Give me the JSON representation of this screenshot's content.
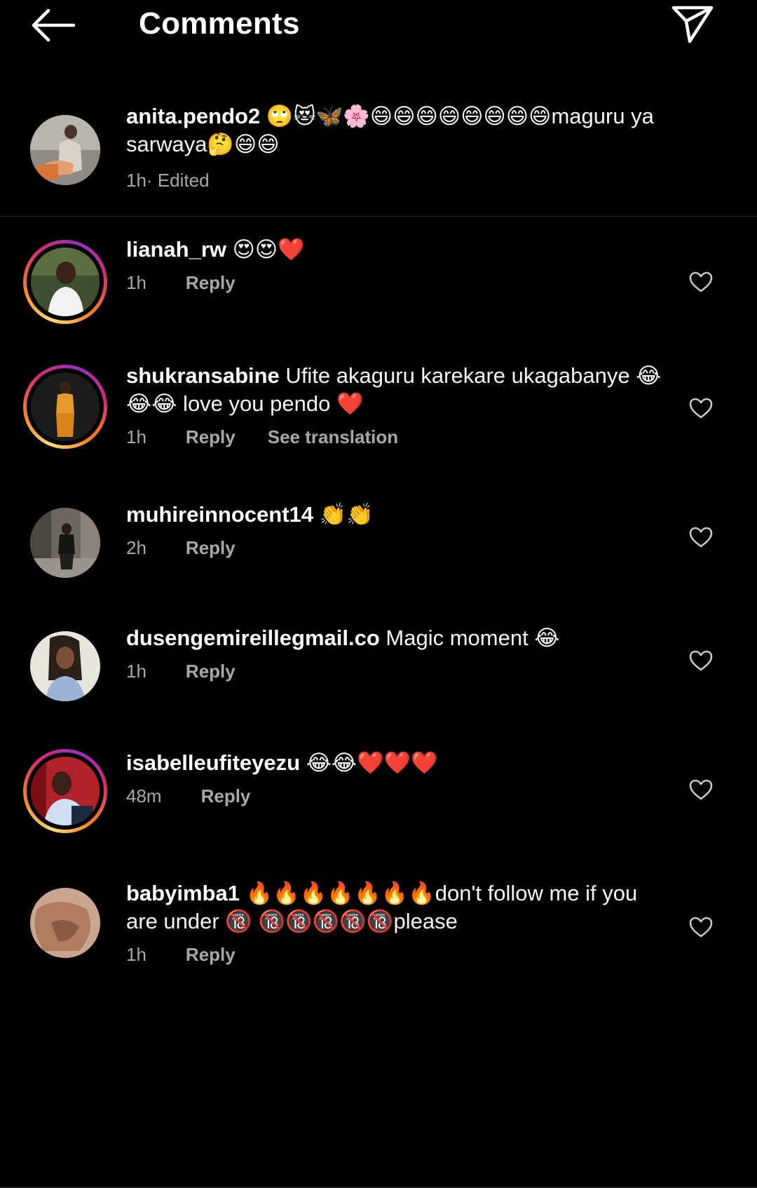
{
  "header": {
    "title": "Comments",
    "back_icon": "arrow-left-icon",
    "share_icon": "paper-plane-icon"
  },
  "caption": {
    "username": "anita.pendo2",
    "text": " 🙄😻🦋🌸😄😄😄😄😄😄😄😄maguru ya sarwaya🤔😄😄",
    "time": "1h",
    "edited": " · Edited"
  },
  "comments": [
    {
      "username": "lianah_rw",
      "text": " 😍😍❤️",
      "time": "1h",
      "reply": "Reply",
      "has_story_ring": true
    },
    {
      "username": "shukransabine",
      "text": " Ufite akaguru karekare  ukagabanye 😂 😂😂 love you pendo ❤️",
      "time": "1h",
      "reply": "Reply",
      "see_translation": "See translation",
      "has_story_ring": true
    },
    {
      "username": "muhireinnocent14",
      "text": " 👏👏",
      "time": "2h",
      "reply": "Reply",
      "has_story_ring": false
    },
    {
      "username": "dusengemireillegmail.co",
      "text": " Magic moment 😂",
      "time": "1h",
      "reply": "Reply",
      "has_story_ring": false
    },
    {
      "username": "isabelleufiteyezu",
      "text": " 😂😂❤️❤️❤️",
      "time": "48m",
      "reply": "Reply",
      "has_story_ring": true
    },
    {
      "username": "babyimba1",
      "text": " 🔥🔥🔥🔥🔥🔥🔥don't follow me if you are under 🔞 🔞🔞🔞🔞🔞please",
      "time": "1h",
      "reply": "Reply",
      "has_story_ring": false
    }
  ],
  "colors": {
    "background": "#000000",
    "text": "#ffffff",
    "muted": "#a8a8a8",
    "divider": "#262626"
  }
}
